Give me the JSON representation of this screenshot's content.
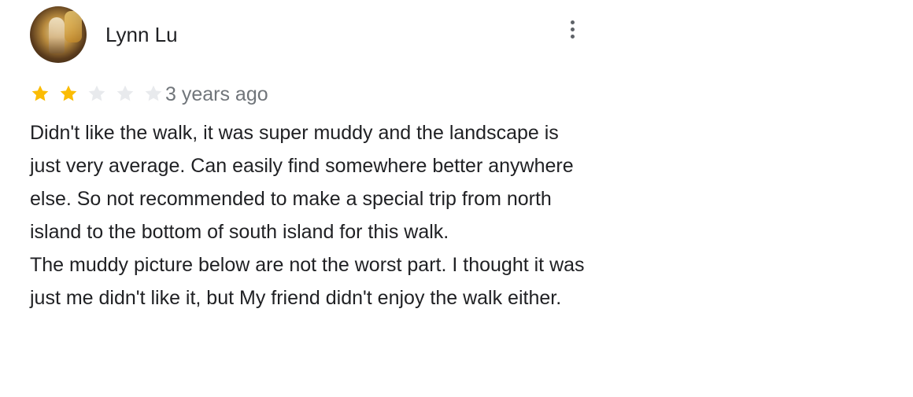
{
  "review": {
    "reviewer_name": "Lynn Lu",
    "avatar_icon": "user-avatar-photo",
    "menu_icon": "more-vert-icon",
    "rating": {
      "value": 2,
      "max": 5,
      "filled_color": "#fbbc04",
      "empty_color": "#e8eaed"
    },
    "time_ago": "3 years ago",
    "paragraphs": [
      "Didn't like the walk, it was super muddy and the landscape is just very average. Can easily find somewhere better anywhere else. So not recommended to make a special trip from north island to the bottom of south island for this walk.",
      "The muddy picture below are not the worst part. I thought it was just me didn't like it, but My friend didn't enjoy the walk either."
    ]
  }
}
